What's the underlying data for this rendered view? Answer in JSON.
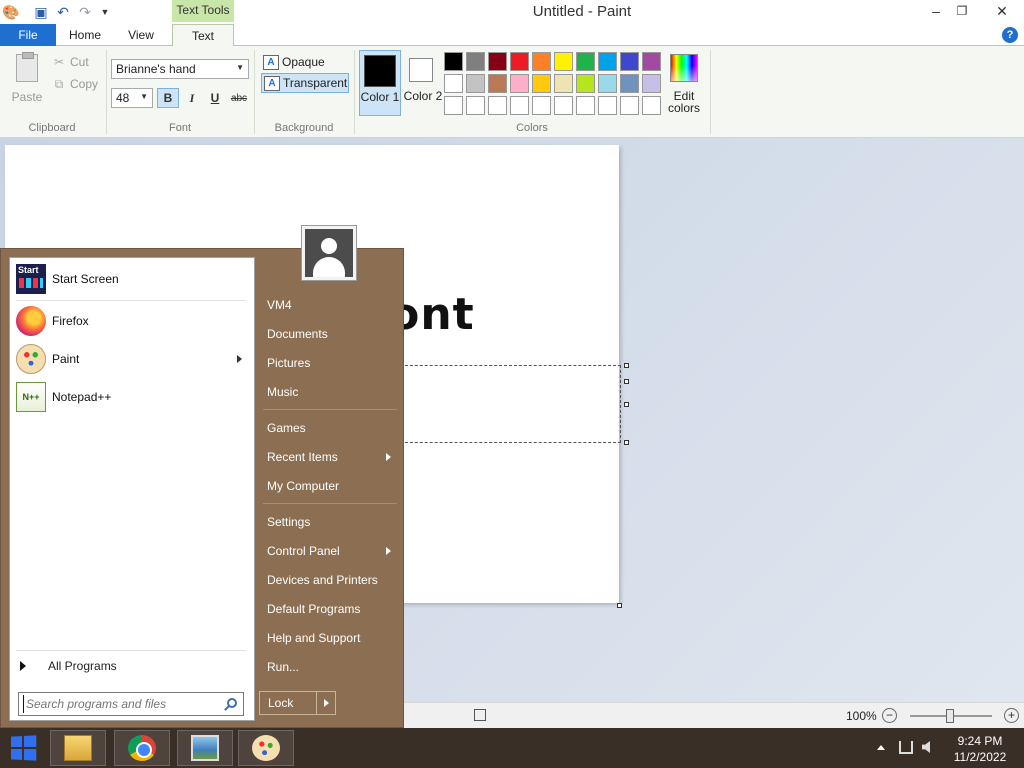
{
  "window": {
    "title": "Untitled - Paint",
    "context_tab_group": "Text Tools",
    "quick_access": {
      "save_icon": "save-icon",
      "undo_icon": "undo-icon",
      "redo_icon": "redo-icon",
      "customize_icon": "chevron-down-icon"
    },
    "controls": {
      "minimize": "–",
      "restore": "❐",
      "close": "✕"
    }
  },
  "tabs": {
    "file": "File",
    "home": "Home",
    "view": "View",
    "text": "Text",
    "help": "?"
  },
  "ribbon": {
    "clipboard": {
      "label": "Clipboard",
      "paste": "Paste",
      "cut": "Cut",
      "copy": "Copy"
    },
    "font": {
      "label": "Font",
      "family": "Brianne's hand",
      "size": "48",
      "bold": "B",
      "italic": "I",
      "underline": "U",
      "strikethrough": "abc"
    },
    "background": {
      "label": "Background",
      "opaque": "Opaque",
      "transparent": "Transparent"
    },
    "colors": {
      "label": "Colors",
      "color1_label": "Color 1",
      "color2_label": "Color 2",
      "color1_value": "#000000",
      "color2_value": "#ffffff",
      "edit_colors": "Edit colors",
      "palette_row1": [
        "#000000",
        "#7f7f7f",
        "#880015",
        "#ed1c24",
        "#ff7f27",
        "#fff200",
        "#22b14c",
        "#00a2e8",
        "#3f48cc",
        "#a349a4"
      ],
      "palette_row2": [
        "#ffffff",
        "#c3c3c3",
        "#b97a57",
        "#ffaec9",
        "#ffc90e",
        "#efe4b0",
        "#b5e61d",
        "#99d9ea",
        "#7092be",
        "#c8bfe7"
      ],
      "palette_row3": [
        "#ffffff",
        "#ffffff",
        "#ffffff",
        "#ffffff",
        "#ffffff",
        "#ffffff",
        "#ffffff",
        "#ffffff",
        "#ffffff",
        "#ffffff"
      ]
    }
  },
  "canvas": {
    "text": "xyz font"
  },
  "statusbar": {
    "zoom": "100%",
    "zoom_out": "−",
    "zoom_in": "+"
  },
  "start_menu": {
    "programs": [
      {
        "label": "Start Screen",
        "icon": "start-screen-icon"
      },
      {
        "label": "Firefox",
        "icon": "firefox-icon"
      },
      {
        "label": "Paint",
        "icon": "paint-icon"
      },
      {
        "label": "Notepad++",
        "icon": "notepad-plus-plus-icon"
      }
    ],
    "start_screen_badge": "Start",
    "notepad_badge": "N++",
    "all_programs": "All Programs",
    "search_placeholder": "Search programs and files",
    "places": [
      "VM4",
      "Documents",
      "Pictures",
      "Music",
      "Games",
      "Recent Items",
      "My Computer",
      "Settings",
      "Control Panel",
      "Devices and Printers",
      "Default Programs",
      "Help and Support",
      "Run..."
    ],
    "lock": "Lock"
  },
  "taskbar": {
    "items": [
      "windows-start-icon",
      "file-explorer-icon",
      "chrome-icon",
      "photos-icon",
      "paint-icon"
    ],
    "clock_time": "9:24 PM",
    "clock_date": "11/2/2022"
  }
}
